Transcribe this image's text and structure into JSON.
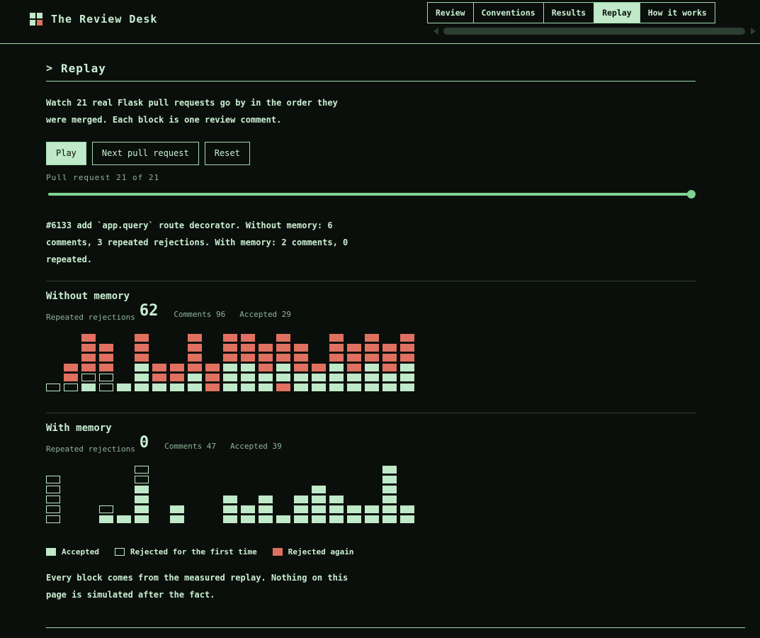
{
  "header": {
    "title": "The Review Desk",
    "tabs": [
      {
        "label": "Review",
        "active": false
      },
      {
        "label": "Conventions",
        "active": false
      },
      {
        "label": "Results",
        "active": false
      },
      {
        "label": "Replay",
        "active": true
      },
      {
        "label": "How it works",
        "active": false
      }
    ]
  },
  "section": {
    "chevron": ">",
    "title": "Replay",
    "intro": "Watch 21 real Flask pull requests go by in the order they were merged. Each block is one review comment."
  },
  "controls": {
    "play_label": "Play",
    "next_label": "Next pull request",
    "reset_label": "Reset"
  },
  "progress": {
    "label": "Pull request 21 of 21",
    "current": 21,
    "total": 21
  },
  "summary": "#6133 add `app.query` route decorator. Without memory: 6 comments, 3 repeated rejections. With memory: 2 comments, 0 repeated.",
  "without_memory": {
    "title": "Without memory",
    "rr_label": "Repeated rejections",
    "rr_value": "62",
    "comments_text": "Comments 96",
    "accepted_text": "Accepted 29",
    "columns": [
      [
        "rej"
      ],
      [
        "rej",
        "again",
        "again"
      ],
      [
        "acc",
        "rej",
        "again",
        "again",
        "again",
        "again"
      ],
      [
        "rej",
        "rej",
        "again",
        "again",
        "again"
      ],
      [
        "acc"
      ],
      [
        "acc",
        "acc",
        "acc",
        "again",
        "again",
        "again"
      ],
      [
        "acc",
        "again",
        "again"
      ],
      [
        "acc",
        "again",
        "again"
      ],
      [
        "acc",
        "acc",
        "again",
        "again",
        "again",
        "again"
      ],
      [
        "again",
        "again",
        "again"
      ],
      [
        "acc",
        "acc",
        "acc",
        "again",
        "again",
        "again"
      ],
      [
        "acc",
        "acc",
        "acc",
        "again",
        "again",
        "again"
      ],
      [
        "acc",
        "acc",
        "again",
        "again",
        "again"
      ],
      [
        "again",
        "acc",
        "acc",
        "again",
        "again",
        "again"
      ],
      [
        "acc",
        "acc",
        "again",
        "again",
        "again"
      ],
      [
        "acc",
        "acc",
        "again"
      ],
      [
        "acc",
        "acc",
        "acc",
        "again",
        "again",
        "again"
      ],
      [
        "acc",
        "acc",
        "again",
        "again",
        "again"
      ],
      [
        "acc",
        "acc",
        "acc",
        "again",
        "again",
        "again"
      ],
      [
        "acc",
        "acc",
        "again",
        "again",
        "again"
      ],
      [
        "acc",
        "acc",
        "acc",
        "again",
        "again",
        "again"
      ]
    ]
  },
  "with_memory": {
    "title": "With memory",
    "rr_label": "Repeated rejections",
    "rr_value": "0",
    "comments_text": "Comments 47",
    "accepted_text": "Accepted 39",
    "columns": [
      [
        "rej",
        "rej",
        "rej",
        "rej",
        "rej"
      ],
      [],
      [],
      [
        "acc",
        "rej"
      ],
      [
        "acc"
      ],
      [
        "acc",
        "acc",
        "acc",
        "acc",
        "rej",
        "rej"
      ],
      [],
      [
        "acc",
        "acc"
      ],
      [],
      [],
      [
        "acc",
        "acc",
        "acc"
      ],
      [
        "acc",
        "acc"
      ],
      [
        "acc",
        "acc",
        "acc"
      ],
      [
        "acc"
      ],
      [
        "acc",
        "acc",
        "acc"
      ],
      [
        "acc",
        "acc",
        "acc",
        "acc"
      ],
      [
        "acc",
        "acc",
        "acc"
      ],
      [
        "acc",
        "acc"
      ],
      [
        "acc",
        "acc"
      ],
      [
        "acc",
        "acc",
        "acc",
        "acc",
        "acc",
        "acc"
      ],
      [
        "acc",
        "acc"
      ]
    ]
  },
  "legend": {
    "accepted": "Accepted",
    "rejected_first": "Rejected for the first time",
    "rejected_again": "Rejected again"
  },
  "footer_note": "Every block comes from the measured replay. Nothing on this page is simulated after the fact.",
  "colors": {
    "background": "#0b0f0c",
    "accent": "#bfe9c8",
    "rejected_again": "#e07060"
  }
}
